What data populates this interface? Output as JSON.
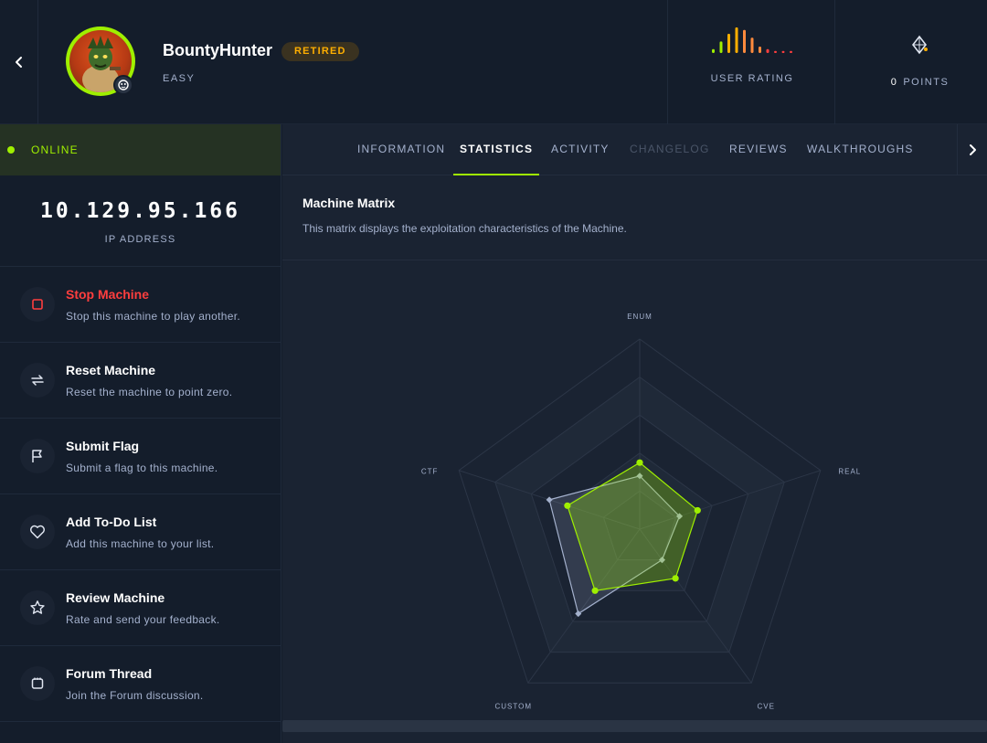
{
  "header": {
    "back_icon": "chevron-left-icon",
    "machine_name": "BountyHunter",
    "status_badge": "RETIRED",
    "difficulty": "EASY",
    "user_rating_label": "USER RATING",
    "points_value": "0",
    "points_label": "POINTS",
    "rating_bars": {
      "levels": [
        0.15,
        0.45,
        0.75,
        1.0,
        0.9,
        0.6,
        0.25,
        0.15,
        0.08,
        0.08,
        0.08
      ],
      "colors": [
        "#9fef00",
        "#9fef00",
        "#ffaf00",
        "#ffaf00",
        "#ff8a3d",
        "#ff8a3d",
        "#ff8a3d",
        "#ff3e3e",
        "#ff3e3e",
        "#ff3e3e",
        "#ff3e3e"
      ]
    }
  },
  "sidebar": {
    "status": "ONLINE",
    "ip": "10.129.95.166",
    "ip_label": "IP ADDRESS",
    "actions": [
      {
        "title": "Stop Machine",
        "desc": "Stop this machine to play another.",
        "icon": "stop-icon"
      },
      {
        "title": "Reset Machine",
        "desc": "Reset the machine to point zero.",
        "icon": "reset-icon"
      },
      {
        "title": "Submit Flag",
        "desc": "Submit a flag to this machine.",
        "icon": "flag-icon"
      },
      {
        "title": "Add To-Do List",
        "desc": "Add this machine to your list.",
        "icon": "heart-icon"
      },
      {
        "title": "Review Machine",
        "desc": "Rate and send your feedback.",
        "icon": "star-icon"
      },
      {
        "title": "Forum Thread",
        "desc": "Join the Forum discussion.",
        "icon": "forum-icon"
      }
    ]
  },
  "tabs": [
    {
      "label": "INFORMATION"
    },
    {
      "label": "STATISTICS"
    },
    {
      "label": "ACTIVITY"
    },
    {
      "label": "CHANGELOG"
    },
    {
      "label": "REVIEWS"
    },
    {
      "label": "WALKTHROUGHS"
    }
  ],
  "active_tab": "STATISTICS",
  "matrix": {
    "title": "Machine Matrix",
    "description": "This matrix displays the exploitation characteristics of the Machine."
  },
  "colors": {
    "accent": "#9fef00",
    "danger": "#ff3e3e",
    "retired": "#ffaf00",
    "user_series": "#a4b1cd"
  },
  "chart_data": {
    "type": "radar",
    "axes": [
      "ENUM",
      "REAL",
      "CVE",
      "CUSTOM",
      "CTF"
    ],
    "rmax": 10,
    "rings": 5,
    "series": [
      {
        "values": [
          3.5,
          3.2,
          3.2,
          4.0,
          4.0
        ],
        "color": "#9fef00"
      },
      {
        "values": [
          2.8,
          2.2,
          2.0,
          5.5,
          5.0
        ],
        "color": "#a4b1cd"
      }
    ]
  }
}
